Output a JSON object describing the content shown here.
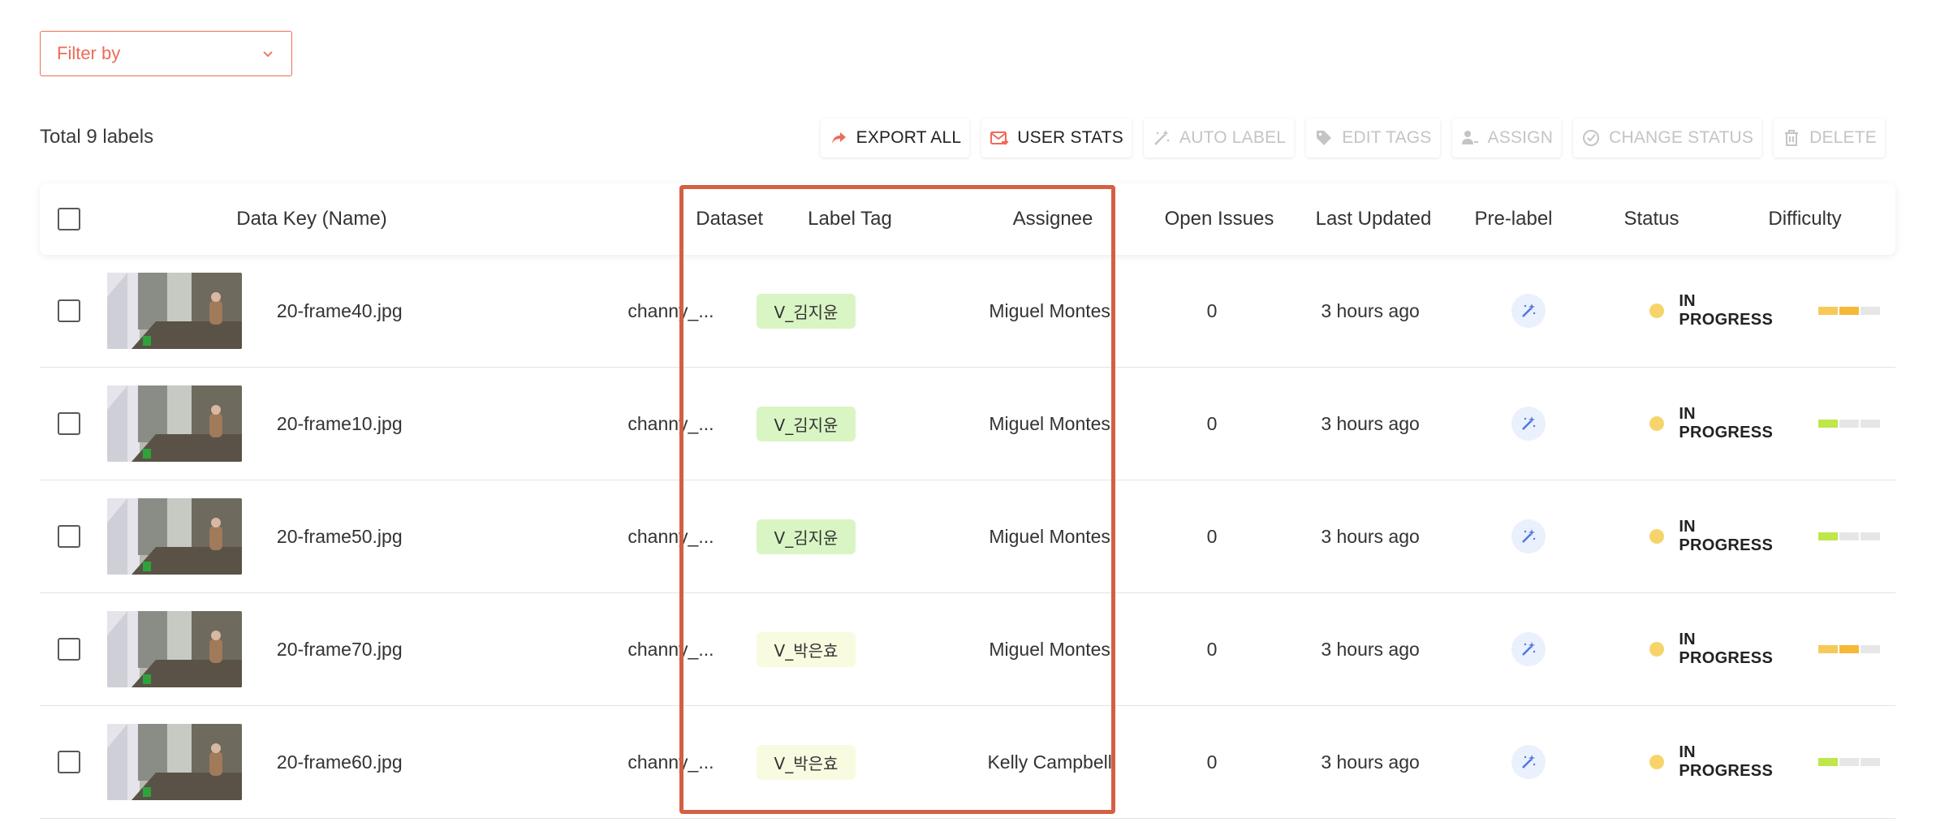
{
  "filter": {
    "label": "Filter by"
  },
  "summary": {
    "total_label": "Total 9 labels"
  },
  "toolbar": {
    "export_all": "EXPORT ALL",
    "user_stats": "USER STATS",
    "auto_label": "AUTO LABEL",
    "edit_tags": "EDIT TAGS",
    "assign": "ASSIGN",
    "change_status": "CHANGE STATUS",
    "delete": "DELETE"
  },
  "table": {
    "headers": {
      "data_key": "Data Key (Name)",
      "dataset": "Dataset",
      "label_tag": "Label Tag",
      "assignee": "Assignee",
      "open_issues": "Open Issues",
      "last_updated": "Last Updated",
      "pre_label": "Pre-label",
      "status": "Status",
      "difficulty": "Difficulty"
    },
    "rows": [
      {
        "name": "20-frame40.jpg",
        "dataset": "channy_...",
        "tag": "V_김지윤",
        "tag_color": "#d9f5c4",
        "assignee": "Miguel Montes",
        "open_issues": "0",
        "updated": "3 hours ago",
        "status": "IN PROGRESS",
        "difficulty": 2
      },
      {
        "name": "20-frame10.jpg",
        "dataset": "channy_...",
        "tag": "V_김지윤",
        "tag_color": "#d9f5c4",
        "assignee": "Miguel Montes",
        "open_issues": "0",
        "updated": "3 hours ago",
        "status": "IN PROGRESS",
        "difficulty": 1
      },
      {
        "name": "20-frame50.jpg",
        "dataset": "channy_...",
        "tag": "V_김지윤",
        "tag_color": "#d9f5c4",
        "assignee": "Miguel Montes",
        "open_issues": "0",
        "updated": "3 hours ago",
        "status": "IN PROGRESS",
        "difficulty": 1
      },
      {
        "name": "20-frame70.jpg",
        "dataset": "channy_...",
        "tag": "V_박은효",
        "tag_color": "#f8fbdf",
        "assignee": "Miguel Montes",
        "open_issues": "0",
        "updated": "3 hours ago",
        "status": "IN PROGRESS",
        "difficulty": 2
      },
      {
        "name": "20-frame60.jpg",
        "dataset": "channy_...",
        "tag": "V_박은효",
        "tag_color": "#f8fbdf",
        "assignee": "Kelly Campbell",
        "open_issues": "0",
        "updated": "3 hours ago",
        "status": "IN PROGRESS",
        "difficulty": 1
      }
    ]
  },
  "icons": {
    "export": "share-arrow-icon",
    "user_stats": "mail-arrow-icon",
    "auto_label": "magic-wand-icon",
    "edit_tags": "tag-icon",
    "assign": "assign-user-icon",
    "change_status": "check-circle-icon",
    "delete": "trash-icon",
    "pre_label": "magic-wand-icon",
    "filter": "chevron-down-icon"
  },
  "colors": {
    "accent": "#ee6b57",
    "highlight_border": "#d45f43",
    "status_in_progress": "#f7d46a",
    "tag_green": "#d9f5c4",
    "tag_yellow": "#f8fbdf",
    "difficulty_low": "#bfe64a",
    "difficulty_medium": "#f5b936"
  }
}
